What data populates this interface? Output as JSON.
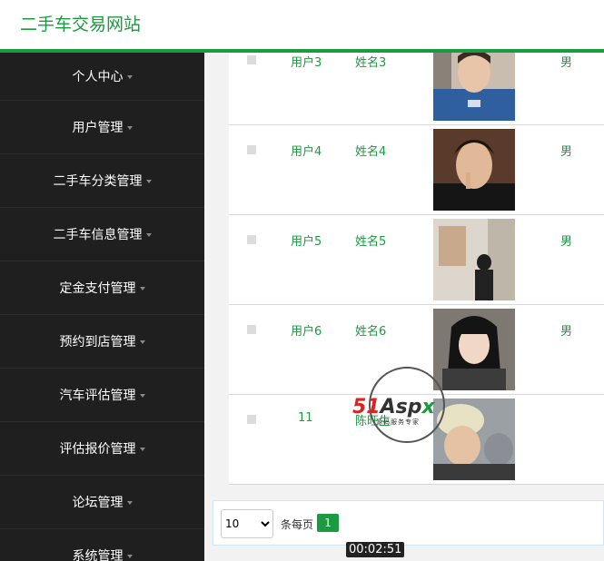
{
  "header": {
    "title": "二手车交易网站"
  },
  "sidebar": {
    "items": [
      {
        "label": "个人中心"
      },
      {
        "label": "用户管理"
      },
      {
        "label": "二手车分类管理"
      },
      {
        "label": "二手车信息管理"
      },
      {
        "label": "定金支付管理"
      },
      {
        "label": "预约到店管理"
      },
      {
        "label": "汽车评估管理"
      },
      {
        "label": "评估报价管理"
      },
      {
        "label": "论坛管理"
      },
      {
        "label": "系统管理"
      }
    ]
  },
  "table": {
    "rows": [
      {
        "account": "用户3",
        "name": "姓名3",
        "gender": "男"
      },
      {
        "account": "用户4",
        "name": "姓名4",
        "gender": "男"
      },
      {
        "account": "用户5",
        "name": "姓名5",
        "gender": "男"
      },
      {
        "account": "用户6",
        "name": "姓名6",
        "gender": "男"
      },
      {
        "account": "11",
        "name": "陈旺生",
        "gender": ""
      }
    ]
  },
  "pagination": {
    "page_size": "10",
    "per_page_label": "条每页",
    "current_page": "1"
  },
  "video_timer": "00:02:51",
  "watermark": {
    "brand": "51Aspx",
    "tagline": "源码服务专家"
  },
  "colors": {
    "accent": "#1a9b3f",
    "sidebar_bg": "#1f1f1f"
  }
}
